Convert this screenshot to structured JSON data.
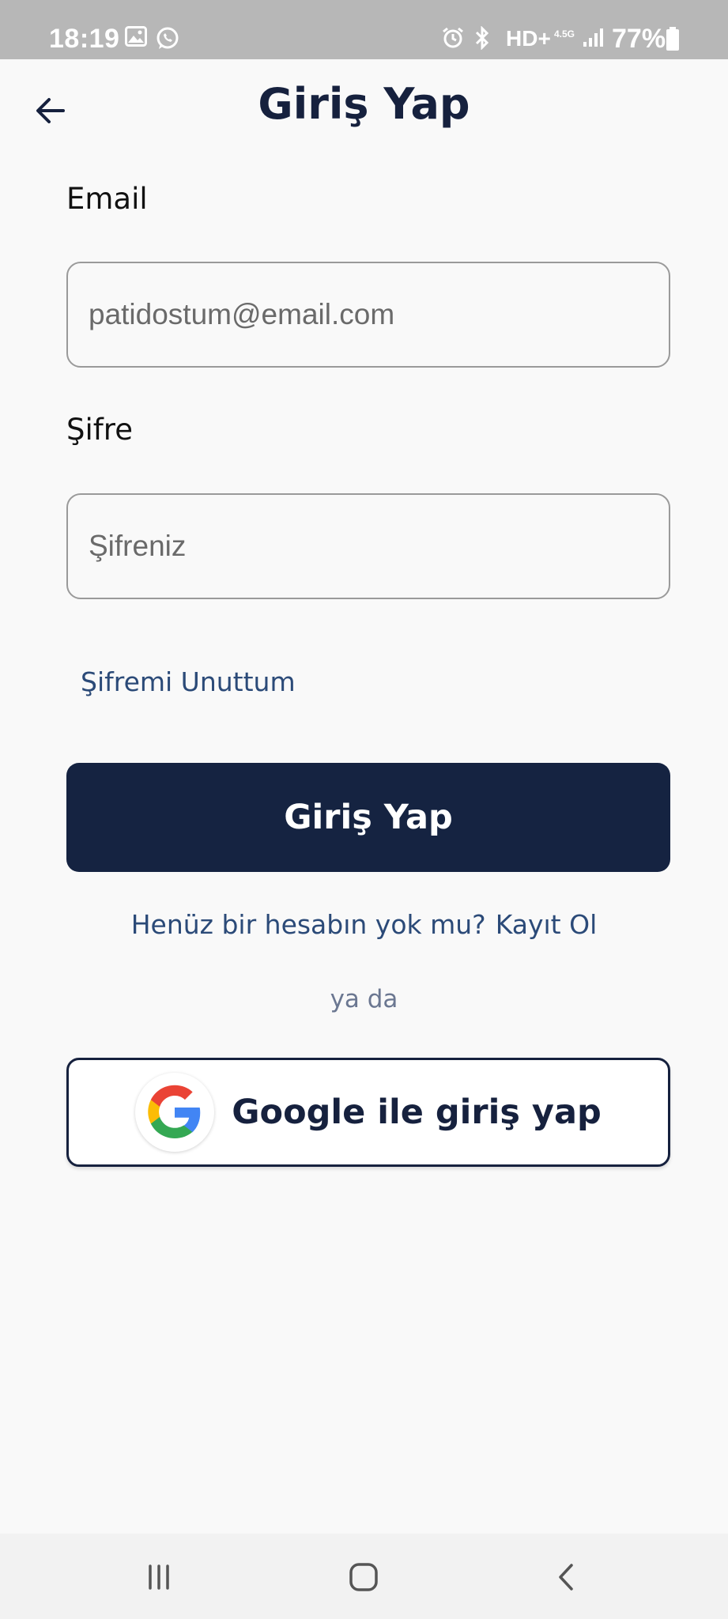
{
  "status_bar": {
    "time": "18:19",
    "network_label": "HD+",
    "network_sub": "4.5G",
    "battery_text": "77%",
    "icons": [
      "image-icon",
      "whatsapp-icon",
      "alarm-icon",
      "bluetooth-icon",
      "signal-icon",
      "battery-icon"
    ]
  },
  "header": {
    "title": "Giriş Yap",
    "back_icon": "arrow-left-icon"
  },
  "form": {
    "email_label": "Email",
    "email_placeholder": "patidostum@email.com",
    "password_label": "Şifre",
    "password_placeholder": "Şifreniz",
    "forgot_link": "Şifremi Unuttum",
    "login_button": "Giriş Yap"
  },
  "signup": {
    "prompt": "Henüz bir hesabın yok mu?",
    "link": "Kayıt Ol"
  },
  "divider_text": "ya da",
  "google": {
    "label": "Google ile giriş yap",
    "icon": "google-icon"
  },
  "nav_bar": {
    "icons": [
      "recent-apps-icon",
      "home-icon",
      "back-icon"
    ]
  },
  "colors": {
    "primary": "#152341",
    "link": "#2b4a78",
    "background": "#f9f9f9",
    "status_bar": "#b7b7b7"
  }
}
